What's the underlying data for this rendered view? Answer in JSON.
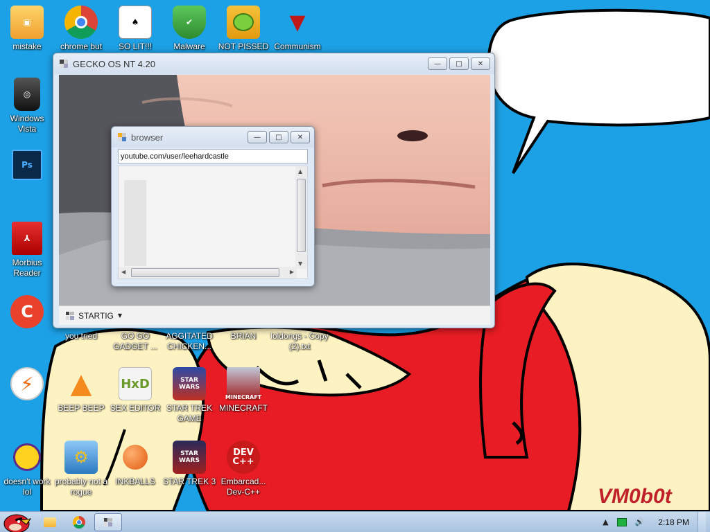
{
  "desktop": {
    "speech_bubble_text": "",
    "watermark": "VM0b0t",
    "icons": [
      {
        "label": "mistake",
        "icon": "folder-app-icon"
      },
      {
        "label": "chrome but",
        "icon": "chrome-icon"
      },
      {
        "label": "SO LIT!!!",
        "icon": "solitaire-icon"
      },
      {
        "label": "Malware",
        "icon": "shield-check-icon"
      },
      {
        "label": "NOT PISSED",
        "icon": "angry-pig-icon"
      },
      {
        "label": "Communism",
        "icon": "emblem-icon"
      },
      {
        "label": "Windows Vista",
        "icon": "trash-bin-icon"
      },
      {
        "label": "",
        "icon": "photoshop-icon"
      },
      {
        "label": "Morbius Reader",
        "icon": "pdf-reader-icon"
      },
      {
        "label": "",
        "icon": "ccleaner-icon"
      },
      {
        "label": "you tried",
        "icon": "blank-icon"
      },
      {
        "label": "GO GO GADGET ...",
        "icon": "blank-icon"
      },
      {
        "label": "AGGITATED CHICKEN...",
        "icon": "blank-icon"
      },
      {
        "label": "BRIAN",
        "icon": "blank-icon"
      },
      {
        "label": "loldongs - Copy (2).txt",
        "icon": "text-file-icon"
      },
      {
        "label": "",
        "icon": "winamp-bolt-icon"
      },
      {
        "label": "BEEP BEEP",
        "icon": "vlc-cone-icon"
      },
      {
        "label": "SEX EDITOR",
        "icon": "hxd-editor-icon"
      },
      {
        "label": "STAR TREK GAME",
        "icon": "star-wars-game-icon"
      },
      {
        "label": "MINECRAFT",
        "icon": "minecraft-icon"
      },
      {
        "label": "doesn't work lol",
        "icon": "yahoo-messenger-icon"
      },
      {
        "label": "probably not a rogue",
        "icon": "control-panel-icon"
      },
      {
        "label": "INKBALLS",
        "icon": "inkball-icon"
      },
      {
        "label": "STAR TREK 3",
        "icon": "star-wars-3-icon"
      },
      {
        "label": "Embarcad... Dev-C++",
        "icon": "devcpp-icon"
      }
    ]
  },
  "gecko_window": {
    "title": "GECKO OS NT 4.20",
    "start_label": "STARTIG",
    "buttons": {
      "minimize": "—",
      "maximize": "□",
      "close": "✕"
    }
  },
  "browser_window": {
    "title": "browser",
    "url": "youtube.com/user/leehardcastle",
    "buttons": {
      "minimize": "—",
      "maximize": "□",
      "close": "✕"
    }
  },
  "taskbar": {
    "clock": "2:18 PM",
    "tray_chevron": "▲",
    "volume_glyph": "🔊"
  },
  "colors": {
    "desktop_bg": "#1da1e6",
    "speech_text": "#e0202a"
  }
}
